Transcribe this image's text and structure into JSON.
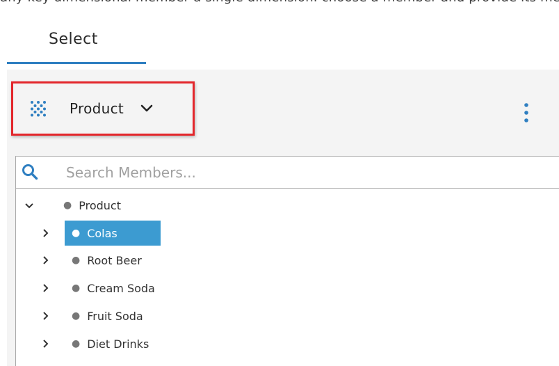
{
  "header": {
    "partial_text": "any key dimensional member a single dimension. choose a member and provide its members to perform"
  },
  "tabs": [
    {
      "label": "Select",
      "active": true
    }
  ],
  "dimension": {
    "label": "Product",
    "icon": "scatter-dots-icon",
    "chevron": "chevron-down-icon"
  },
  "menu": {
    "icon": "kebab-menu-icon"
  },
  "search": {
    "placeholder": "Search Members...",
    "value": ""
  },
  "tree": {
    "root": {
      "label": "Product",
      "expanded": true
    },
    "children": [
      {
        "label": "Colas",
        "selected": true
      },
      {
        "label": "Root Beer",
        "selected": false
      },
      {
        "label": "Cream Soda",
        "selected": false
      },
      {
        "label": "Fruit Soda",
        "selected": false
      },
      {
        "label": "Diet Drinks",
        "selected": false
      }
    ]
  },
  "colors": {
    "accent": "#2f7fc1",
    "highlight": "#e3262b",
    "selection": "#3c9bd1",
    "panel": "#f4f4f4"
  }
}
